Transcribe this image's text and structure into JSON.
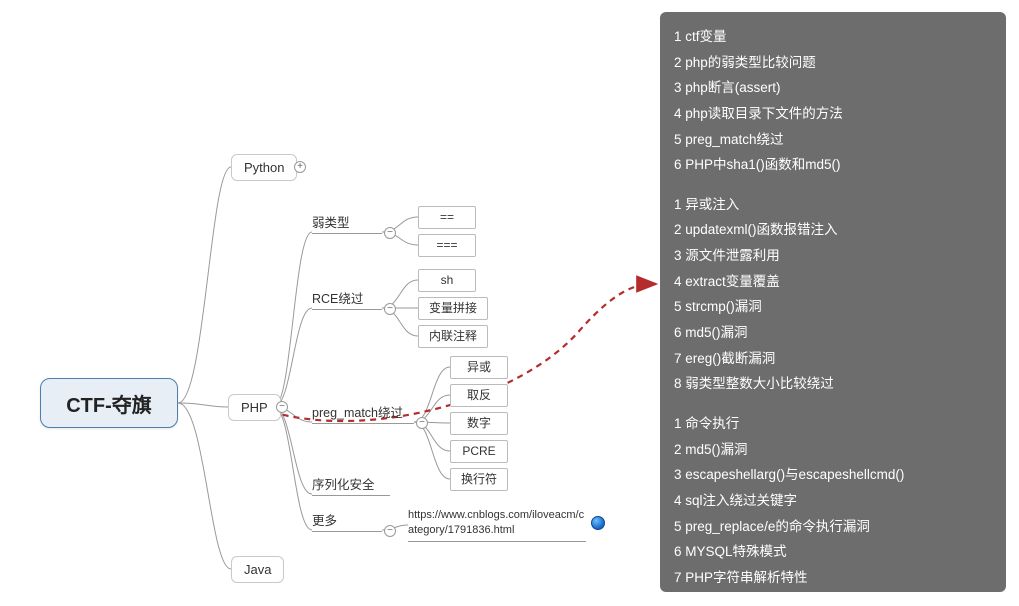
{
  "central": {
    "title": "CTF-夺旗"
  },
  "mains": {
    "python": "Python",
    "php": "PHP",
    "java": "Java"
  },
  "php_subs": {
    "weak": "弱类型",
    "rce": "RCE绕过",
    "pmatch": "preg_match绕过",
    "serial": "序列化安全",
    "more": "更多"
  },
  "leaves": {
    "weak": [
      "==",
      "==="
    ],
    "rce": [
      "sh",
      "变量拼接",
      "内联注释"
    ],
    "pmatch": [
      "异或",
      "取反",
      "数字",
      "PCRE",
      "换行符"
    ],
    "more_url": "https://www.cnblogs.com/iloveacm/category/1791836.html"
  },
  "notes": {
    "g1": [
      "1 ctf变量",
      "2 php的弱类型比较问题",
      "3 php断言(assert)",
      "4 php读取目录下文件的方法",
      "5 preg_match绕过",
      "6 PHP中sha1()函数和md5()"
    ],
    "g2": [
      "1 异或注入",
      "2 updatexml()函数报错注入",
      "3 源文件泄露利用",
      "4 extract变量覆盖",
      "5 strcmp()漏洞",
      "6 md5()漏洞",
      "7 ereg()截断漏洞",
      "8 弱类型整数大小比较绕过"
    ],
    "g3": [
      "1 命令执行",
      "2 md5()漏洞",
      "3 escapeshellarg()与escapeshellcmd()",
      "4 sql注入绕过关键字",
      "5 preg_replace/e的命令执行漏洞",
      "6 MYSQL特殊模式",
      "7 PHP字符串解析特性"
    ]
  },
  "chart_data": {
    "type": "mindmap",
    "root": "CTF-夺旗",
    "children": [
      {
        "name": "Python",
        "collapsed": true
      },
      {
        "name": "PHP",
        "collapsed": false,
        "children": [
          {
            "name": "弱类型",
            "children": [
              "==",
              "==="
            ]
          },
          {
            "name": "RCE绕过",
            "children": [
              "sh",
              "变量拼接",
              "内联注释"
            ]
          },
          {
            "name": "preg_match绕过",
            "children": [
              "异或",
              "取反",
              "数字",
              "PCRE",
              "换行符"
            ]
          },
          {
            "name": "序列化安全"
          },
          {
            "name": "更多",
            "link": "https://www.cnblogs.com/iloveacm/category/1791836.html"
          }
        ]
      },
      {
        "name": "Java"
      }
    ],
    "callout_arrow": {
      "from": "PHP",
      "to": "notes-panel",
      "style": "dashed-red"
    }
  }
}
